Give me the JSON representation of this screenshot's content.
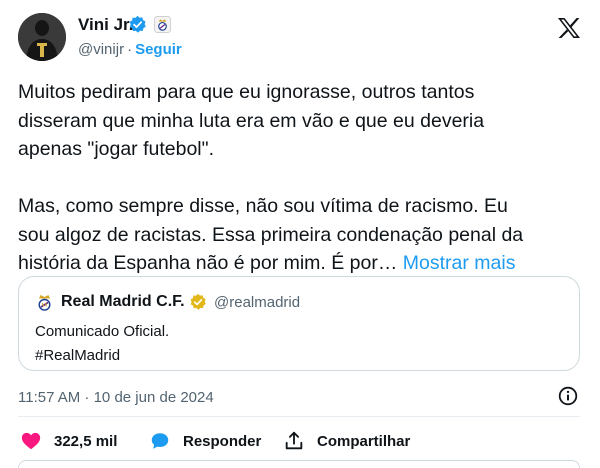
{
  "author": {
    "name": "Vini Jr.",
    "handle": "@vinijr",
    "separator": "·",
    "follow_label": "Seguir"
  },
  "icons": {
    "verified": "verified-badge-icon",
    "club_badge": "real-madrid-crest-icon",
    "platform": "x-logo-icon",
    "info": "info-icon",
    "like": "heart-icon",
    "reply": "speech-bubble-icon",
    "share": "share-icon"
  },
  "colors": {
    "accent": "#1d9bf0",
    "verified_blue": "#1d9bf0",
    "verified_gold": "#e2b719",
    "like_red": "#f91880",
    "secondary_text": "#536471",
    "border": "#cfd9de"
  },
  "tweet": {
    "text": "Muitos pediram para que eu ignorasse, outros tantos\ndisseram que minha luta era em vão e que eu deveria\napenas \"jogar futebol\".\n\nMas, como sempre disse, não sou vítima de racismo. Eu\nsou algoz de racistas. Essa primeira condenação penal da\nhistória da Espanha não é por mim. É por… ",
    "show_more_label": "Mostrar mais",
    "timestamp": "11:57 AM · 10 de jun de 2024"
  },
  "quote": {
    "name": "Real Madrid C.F.",
    "handle": "@realmadrid",
    "line1": "Comunicado Oficial.",
    "line2": "#RealMadrid"
  },
  "actions": {
    "likes": "322,5 mil",
    "reply_label": "Responder",
    "share_label": "Compartilhar"
  }
}
